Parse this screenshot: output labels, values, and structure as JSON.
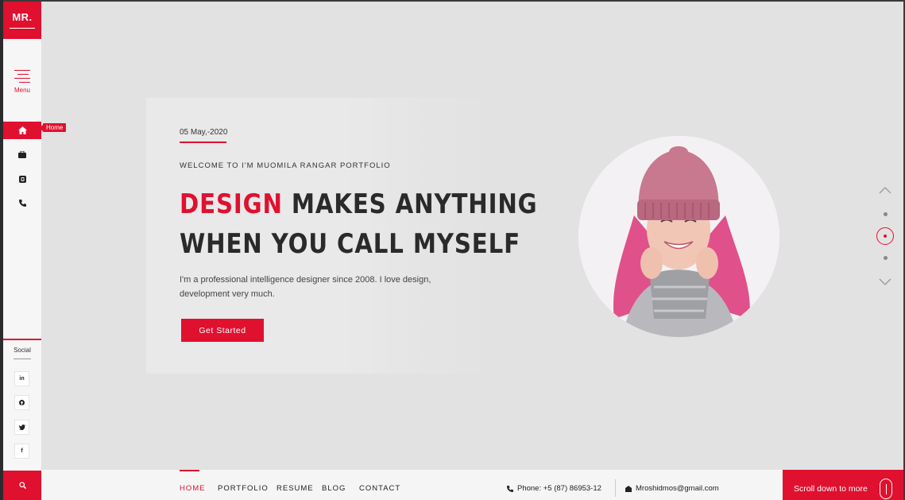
{
  "sidebar": {
    "logo": "MR.",
    "menu_label": "Menu",
    "nav_items": [
      {
        "icon": "home-icon",
        "label": "Home",
        "active": true
      },
      {
        "icon": "briefcase-icon"
      },
      {
        "icon": "blog-icon"
      },
      {
        "icon": "phone-icon"
      }
    ],
    "social_label": "Social",
    "social_items": [
      {
        "icon": "linkedin-icon",
        "glyph": "in"
      },
      {
        "icon": "pinterest-icon",
        "glyph": "℗"
      },
      {
        "icon": "twitter-icon",
        "glyph": "🐦"
      },
      {
        "icon": "facebook-icon",
        "glyph": "f"
      }
    ]
  },
  "hero": {
    "date": "05 May,-2020",
    "welcome": "WELCOME TO I'M MUOMILA RANGAR PORTFOLIO",
    "heading_accent": "DESIGN",
    "heading_rest_line1": " MAKES ANYTHING",
    "heading_line2": "WHEN YOU CALL MYSELF",
    "description": "I'm a professional intelligence designer since 2008. I love design, development very much.",
    "cta_label": "Get Started"
  },
  "footer": {
    "nav": [
      "HOME",
      "PORTFOLIO",
      "RESUME",
      "BLOG",
      "CONTACT"
    ],
    "active_nav": "HOME",
    "phone": "Phone: +5 (87) 86953-12",
    "email": "Mroshidmos@gmail.com",
    "scroll_label": "Scroll down to more"
  },
  "colors": {
    "accent": "#e0102f",
    "background": "#e2e2e2",
    "sidebar": "#f6f6f6"
  }
}
